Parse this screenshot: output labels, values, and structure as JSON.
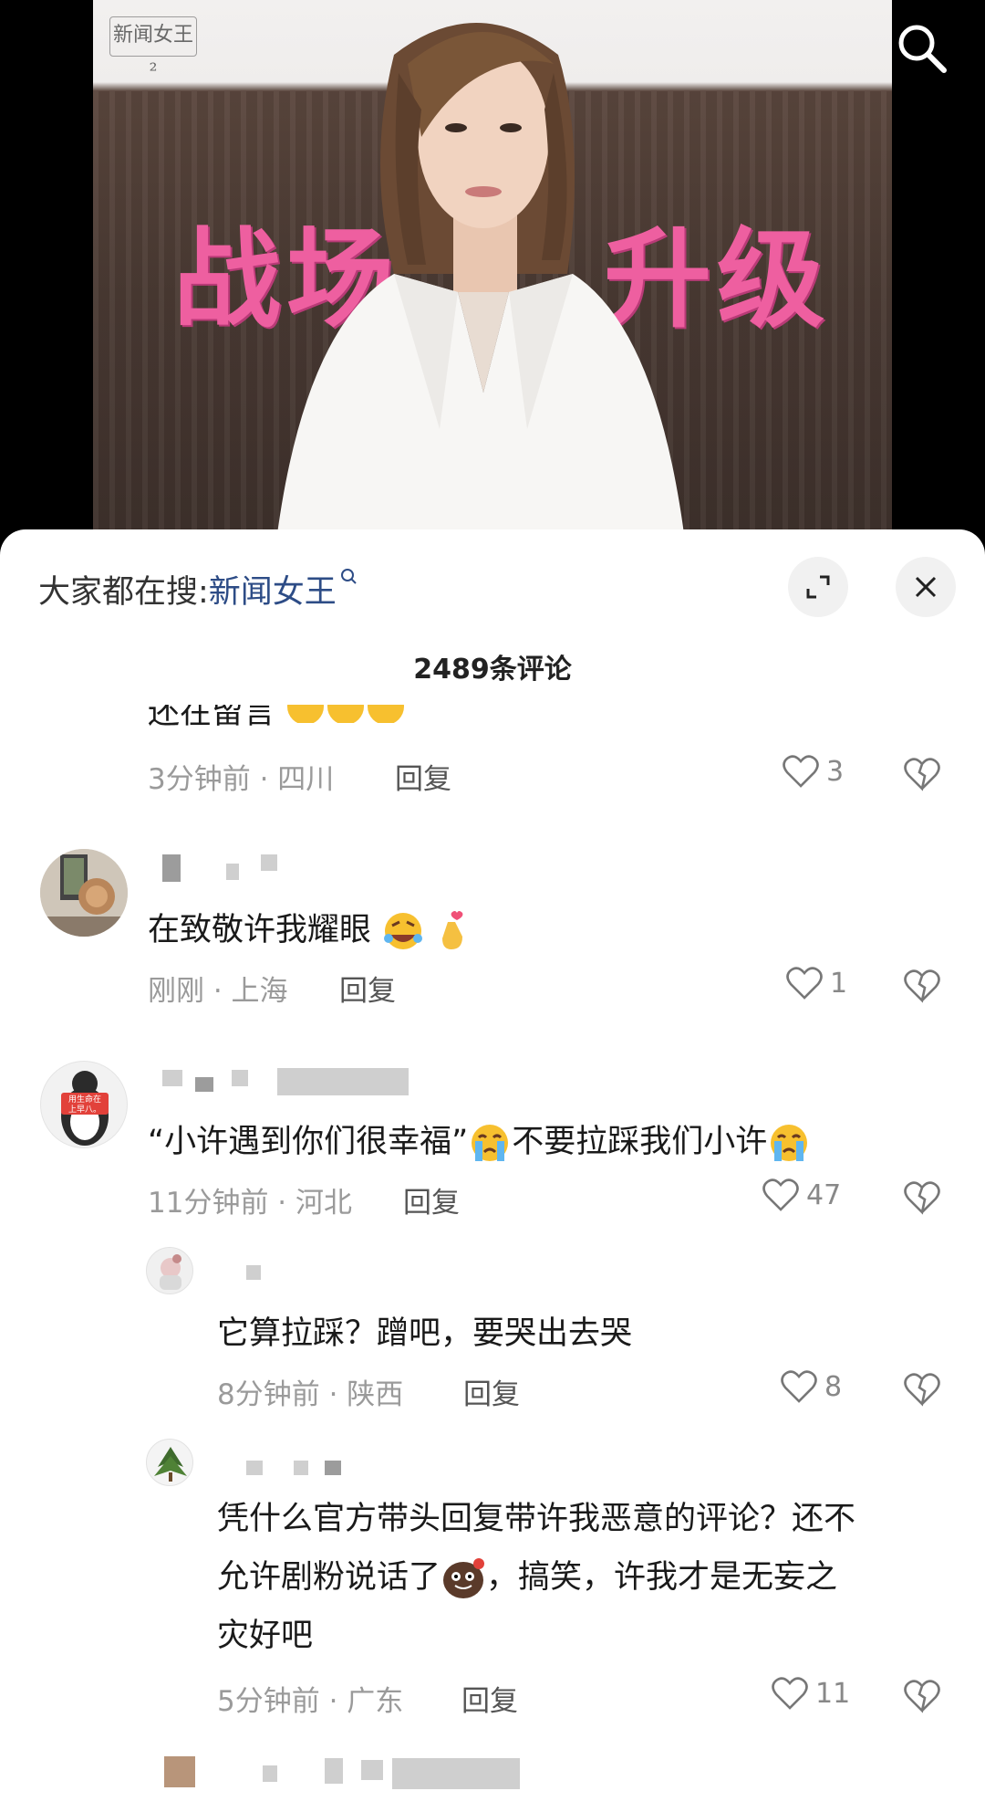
{
  "video": {
    "logo_text": "新闻女王²",
    "overlay_left": "战场",
    "overlay_right": "升级"
  },
  "sheet": {
    "hot_search_prefix": "大家都在搜:",
    "hot_search_keyword": "新闻女王",
    "comment_count": "2489条评论"
  },
  "comments": [
    {
      "text_partial": "还在留言",
      "time_location": "3分钟前 · 四川",
      "reply_label": "回复",
      "likes": "3"
    },
    {
      "text": "在致敬许我耀眼",
      "time_location": "刚刚 · 上海",
      "reply_label": "回复",
      "likes": "1"
    },
    {
      "text_a": "“小许遇到你们很幸福”",
      "text_b": "不要拉踩我们小许",
      "avatar_sign": "用生命在上早八。",
      "time_location": "11分钟前 · 河北",
      "reply_label": "回复",
      "likes": "47"
    }
  ],
  "replies": [
    {
      "text": "它算拉踩？蹭吧，要哭出去哭",
      "time_location": "8分钟前 · 陕西",
      "reply_label": "回复",
      "likes": "8"
    },
    {
      "line1": "凭什么官方带头回复带许我恶意的评论？还不",
      "line2a": "允许剧粉说话了",
      "line2b": "，搞笑，许我才是无妄之",
      "line3": "灾好吧",
      "time_location": "5分钟前 · 广东",
      "reply_label": "回复",
      "likes": "11"
    }
  ],
  "colors": {
    "overlay_pink": "#ee5fa0",
    "keyword_blue": "#2d4c86",
    "meta_gray": "#9a9a9a"
  },
  "icons": [
    "search-icon",
    "expand-icon",
    "close-icon",
    "heart-icon",
    "broken-heart-icon",
    "crying-emoji",
    "laughing-emoji",
    "finger-heart-emoji",
    "poop-emoji"
  ]
}
